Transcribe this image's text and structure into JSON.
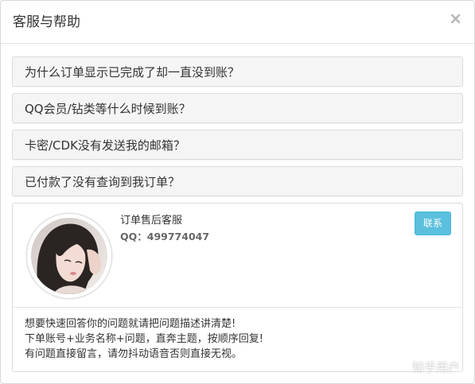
{
  "modal": {
    "title": "客服与帮助",
    "close_glyph": "×"
  },
  "faq": [
    {
      "label": "为什么订单显示已完成了却一直没到账？"
    },
    {
      "label": "QQ会员/钻类等什么时候到账？"
    },
    {
      "label": "卡密/CDK没有发送我的邮箱？"
    },
    {
      "label": "已付款了没有查询到我订单？"
    }
  ],
  "service": {
    "name": "订单售后客服",
    "qq": "QQ：499774047",
    "contact_label": "联系",
    "notes": [
      "想要快速回答你的问题就请把问题描述讲清楚!",
      "下单账号+业务名称+问题，直奔主题，按顺序回复!",
      "有问题直接留言，请勿抖动语音否则直接无视。"
    ]
  },
  "watermark": "知乎用户",
  "colors": {
    "contact_button": "#5bc0de",
    "faq_background": "#f5f5f5",
    "border": "#dcdcdc"
  }
}
